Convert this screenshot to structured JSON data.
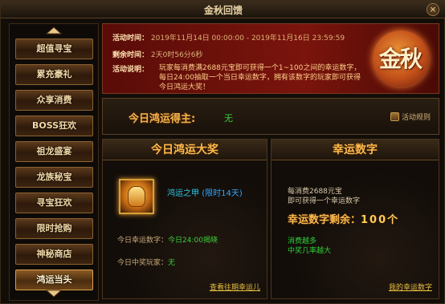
{
  "window": {
    "title": "金秋回馈",
    "close_label": "×"
  },
  "sidebar": {
    "items": [
      {
        "label": "超值寻宝"
      },
      {
        "label": "累充豪礼"
      },
      {
        "label": "众享消费"
      },
      {
        "label": "BOSS狂欢"
      },
      {
        "label": "祖龙盛宴"
      },
      {
        "label": "龙族秘宝"
      },
      {
        "label": "寻宝狂欢"
      },
      {
        "label": "限时抢购"
      },
      {
        "label": "神秘商店"
      },
      {
        "label": "鸿运当头"
      }
    ]
  },
  "banner": {
    "time_label": "活动时间：",
    "time_value": "2019年11月14日 00:00:00 - 2019年11月16日 23:59:59",
    "remain_label": "剩余时间：",
    "remain_value": "2天0时56分6秒",
    "desc_label": "活动说明：",
    "desc_value": "玩家每消费满2688元宝即可获得一个1~100之间的幸运数字，每日24:00抽取一个当日幸运数字，拥有该数字的玩家即可获得今日鸿运大奖！",
    "logo_text": "金秋"
  },
  "winner": {
    "label": "今日鸿运得主:",
    "value": "无",
    "rules_label": "活动规则"
  },
  "left_panel": {
    "title": "今日鸿运大奖",
    "prize_name": "鸿运之甲",
    "prize_tag": "(限时14天)",
    "lucky_label": "今日幸运数字：",
    "lucky_value": "今日24:00揭晓",
    "winner_label": "今日中奖玩家：",
    "winner_value": "无",
    "link": "查看往期幸运儿"
  },
  "right_panel": {
    "title": "幸运数字",
    "line1": "每消费2688元宝",
    "line2": "即可获得一个幸运数字",
    "remain_label": "幸运数字剩余：",
    "remain_value": "100个",
    "green1": "消费越多",
    "green2": "中奖几率越大",
    "link": "我的幸运数字"
  },
  "colors": {
    "accent": "#ffbb4c",
    "success": "#3ccd3a",
    "link": "#e8c040"
  }
}
